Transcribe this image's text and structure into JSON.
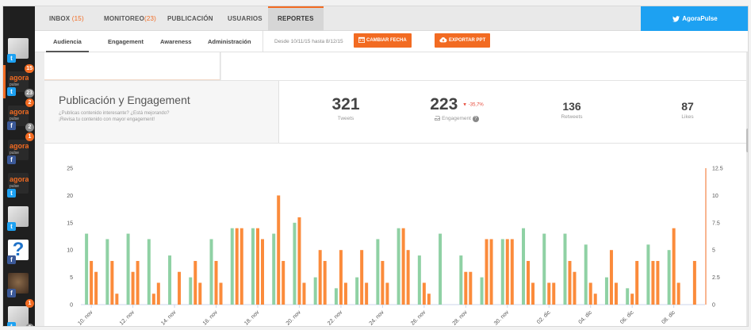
{
  "sidebar": {
    "accounts": [
      {
        "avatar": "profile-photo",
        "network": "twitter",
        "badge_top": "",
        "badge_bottom": ""
      },
      {
        "avatar": "agora-logo",
        "logo_text": "agora",
        "logo_sub": "pulse",
        "network": "twitter",
        "badge_top": "15",
        "badge_bottom": "23"
      },
      {
        "avatar": "agora-logo",
        "logo_text": "agora",
        "logo_sub": "pulse",
        "network": "facebook",
        "badge_top": "2",
        "badge_bottom": "2"
      },
      {
        "avatar": "agora-logo",
        "logo_text": "agora",
        "logo_sub": "pulse",
        "network": "facebook",
        "badge_top": "1",
        "badge_bottom": ""
      },
      {
        "avatar": "agora-logo",
        "logo_text": "agora",
        "logo_sub": "pulse",
        "network": "twitter",
        "badge_top": "",
        "badge_bottom": ""
      },
      {
        "avatar": "profile-photo",
        "network": "twitter",
        "badge_top": "",
        "badge_bottom": ""
      },
      {
        "avatar": "question-logo",
        "network": "facebook",
        "badge_top": "",
        "badge_bottom": ""
      },
      {
        "avatar": "dog-photo",
        "network": "facebook",
        "badge_top": "",
        "badge_bottom": ""
      },
      {
        "avatar": "profile-photo",
        "network": "twitter",
        "badge_top": "1",
        "badge_bottom": "3"
      }
    ]
  },
  "topnav": {
    "tabs": [
      {
        "label": "INBOX",
        "count": "(15)"
      },
      {
        "label": "MONITOREO",
        "count": "(23)"
      },
      {
        "label": "PUBLICACIÓN",
        "count": ""
      },
      {
        "label": "USUARIOS",
        "count": ""
      },
      {
        "label": "REPORTES",
        "count": ""
      }
    ],
    "active_tab": "REPORTES",
    "brand": "AgoraPulse"
  },
  "subnav": {
    "tabs": [
      "Audiencia",
      "Engagement",
      "Awareness",
      "Administración"
    ],
    "active_tab": "Audiencia",
    "date_range": "Desde 10/11/15 hasta 8/12/15",
    "change_date_button": "CAMBIAR FECHA",
    "export_button": "EXPORTAR PPT"
  },
  "summary": {
    "title": "Publicación y Engagement",
    "subtitle_1": "¿Publicas contenido interesante? ¿Está mejorando?",
    "subtitle_2": "¡Revisa tu contenido con mayor engagement!",
    "stats": {
      "tweets": {
        "value": "321",
        "label": "Tweets"
      },
      "engagement": {
        "value": "223",
        "delta": "-35,7%",
        "label": "Engagement"
      },
      "retweets": {
        "value": "136",
        "label": "Retweets"
      },
      "likes": {
        "value": "87",
        "label": "Likes"
      }
    }
  },
  "colors": {
    "accent": "#f26b22",
    "green_series": "#8fd1a4",
    "orange_series": "#fb8b3b",
    "twitter": "#1da1f2",
    "facebook": "#3b5998"
  },
  "chart_data": {
    "type": "bar",
    "categories": [
      "10. nov",
      "11. nov",
      "12. nov",
      "13. nov",
      "14. nov",
      "15. nov",
      "16. nov",
      "17. nov",
      "18. nov",
      "19. nov",
      "20. nov",
      "21. nov",
      "22. nov",
      "23. nov",
      "24. nov",
      "25. nov",
      "26. nov",
      "27. nov",
      "28. nov",
      "29. nov",
      "30. nov",
      "01. dic",
      "02. dic",
      "03. dic",
      "04. dic",
      "05. dic",
      "06. dic",
      "07. dic",
      "08. dic",
      "09. dic"
    ],
    "tick_labels": [
      "10. nov",
      "12. nov",
      "14. nov",
      "16. nov",
      "18. nov",
      "20. nov",
      "22. nov",
      "24. nov",
      "26. nov",
      "28. nov",
      "30. nov",
      "02. dic",
      "04. dic",
      "06. dic",
      "08. dic"
    ],
    "series": [
      {
        "axis": "left",
        "color": "#8fd1a4",
        "values": [
          13,
          12,
          13,
          12,
          9,
          5,
          12,
          14,
          14,
          13,
          15,
          5,
          3,
          5,
          12,
          14,
          9,
          13,
          9,
          5,
          12,
          14,
          13,
          13,
          11,
          5,
          3,
          11,
          10,
          0
        ]
      },
      {
        "axis": "left",
        "color": "#fb8b3b",
        "values": [
          8,
          8,
          6,
          2,
          0,
          8,
          8,
          14,
          14,
          20,
          16,
          10,
          10,
          10,
          8,
          14,
          4,
          0,
          6,
          12,
          12,
          8,
          4,
          8,
          4,
          10,
          2,
          8,
          14,
          8
        ]
      },
      {
        "axis": "right",
        "color": "#fb8b3b",
        "values": [
          3,
          1,
          4,
          2,
          3,
          2,
          2,
          7,
          6,
          4,
          2,
          4,
          2,
          2,
          2,
          5,
          1,
          0,
          3,
          6,
          6,
          2,
          2,
          3,
          1,
          2,
          4,
          4,
          2,
          0
        ]
      }
    ],
    "ylim_left": [
      0,
      25
    ],
    "yticks_left": [
      "0",
      "5",
      "10",
      "15",
      "20",
      "25"
    ],
    "ylim_right": [
      0,
      12.5
    ],
    "yticks_right": [
      "0",
      "2.5",
      "5",
      "7.5",
      "10",
      "12.5"
    ],
    "grid": false
  }
}
